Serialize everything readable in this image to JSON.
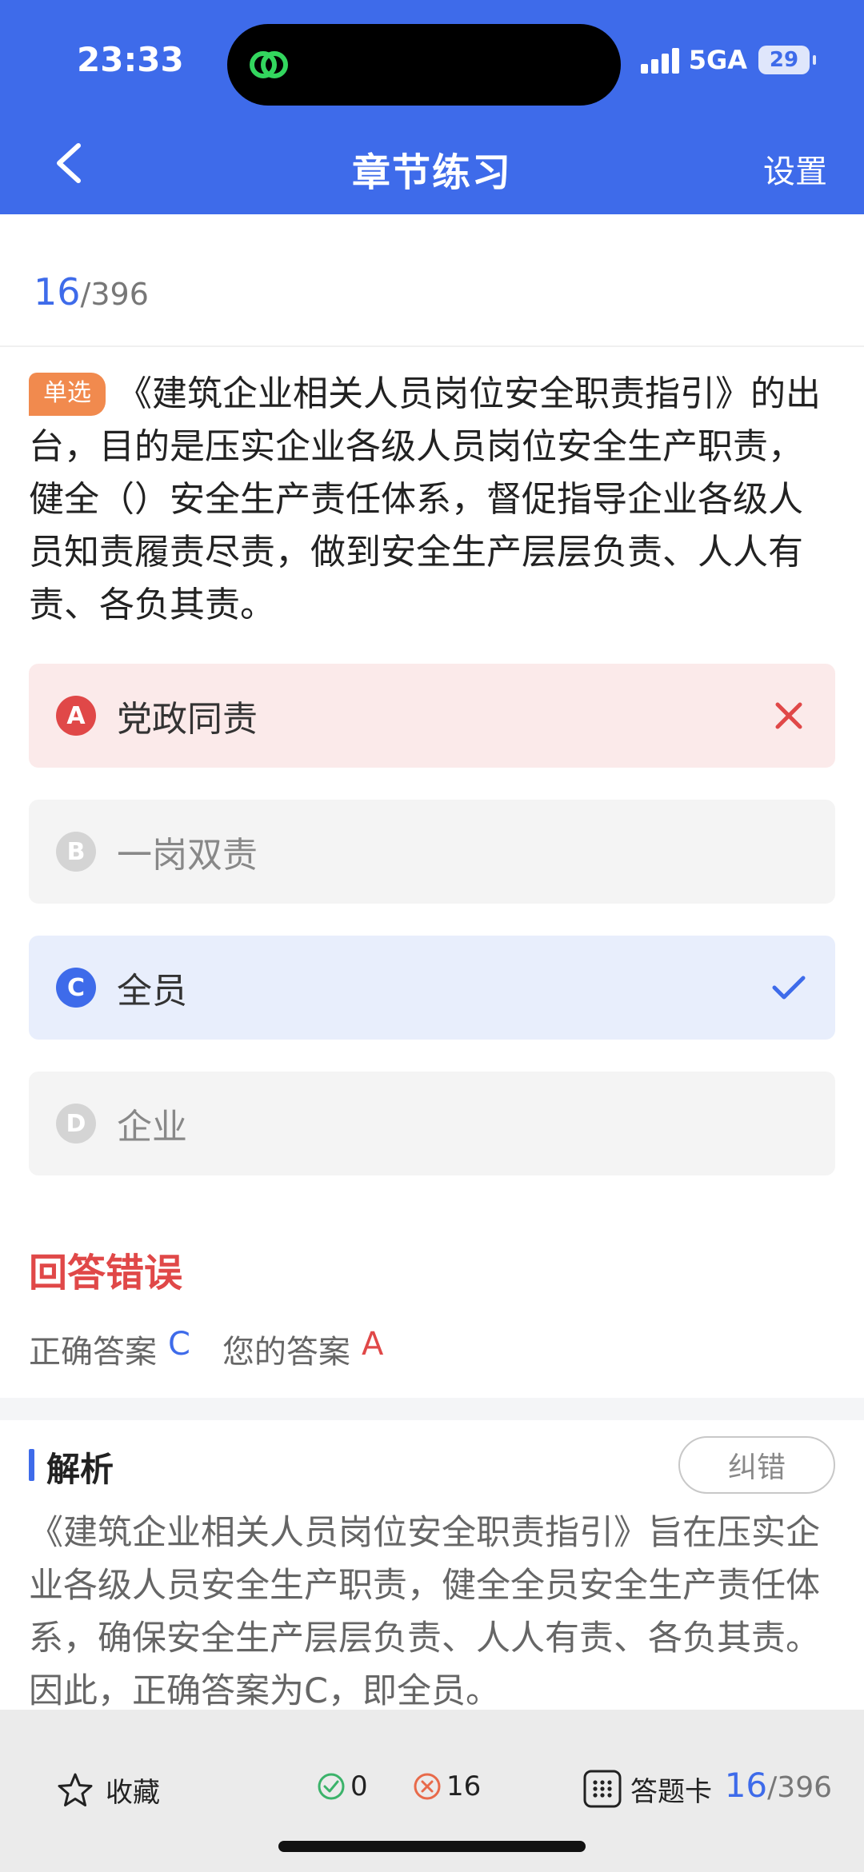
{
  "status_bar": {
    "time": "23:33",
    "network": "5GA",
    "battery": "29"
  },
  "nav": {
    "title": "章节练习",
    "settings_label": "设置"
  },
  "progress": {
    "current": "16",
    "total": "/396"
  },
  "question": {
    "type_badge": "单选",
    "text": "《建筑企业相关人员岗位安全职责指引》的出台，目的是压实企业各级人员岗位安全生产职责，健全（）安全生产责任体系，督促指导企业各级人员知责履责尽责，做到安全生产层层负责、人人有责、各负其责。"
  },
  "options": [
    {
      "letter": "A",
      "text": "党政同责",
      "state": "wrong"
    },
    {
      "letter": "B",
      "text": "一岗双责",
      "state": "plain"
    },
    {
      "letter": "C",
      "text": "全员",
      "state": "correct"
    },
    {
      "letter": "D",
      "text": "企业",
      "state": "plain"
    }
  ],
  "result": {
    "title": "回答错误",
    "correct_label": "正确答案",
    "correct_value": "C",
    "yours_label": "您的答案",
    "yours_value": "A"
  },
  "analysis": {
    "title": "解析",
    "report_label": "纠错",
    "text": "《建筑企业相关人员岗位安全职责指引》旨在压实企业各级人员安全生产职责，健全全员安全生产责任体系，确保安全生产层层负责、人人有责、各负其责。因此，正确答案为C，即全员。"
  },
  "bottom_bar": {
    "favorite_label": "收藏",
    "correct_count": "0",
    "wrong_count": "16",
    "answer_card_label": "答题卡",
    "progress_current": "16",
    "progress_total": "/396"
  },
  "colors": {
    "primary": "#3e6bea",
    "error": "#e04848",
    "badge": "#f18a4e",
    "success": "#3bb36a"
  },
  "icons": [
    "back-chevron-icon",
    "app-link-icon",
    "signal-icon",
    "battery-icon",
    "wrong-x-icon",
    "correct-check-icon",
    "star-icon",
    "check-circle-icon",
    "x-circle-icon",
    "grid-icon"
  ]
}
